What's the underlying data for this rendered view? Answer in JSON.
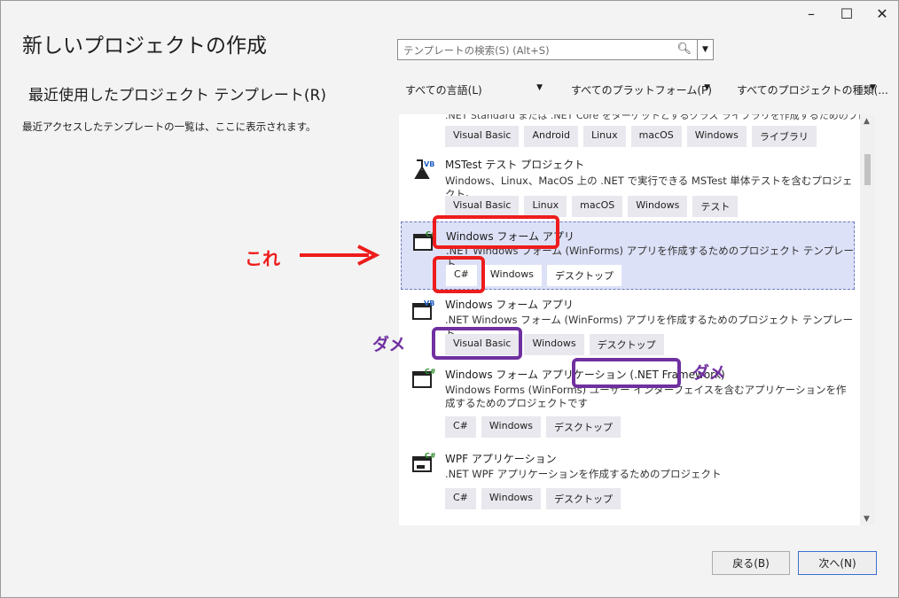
{
  "window": {
    "minimize_icon": "minimize-icon",
    "maximize_icon": "maximize-icon",
    "close_icon": "close-icon"
  },
  "title": "新しいプロジェクトの作成",
  "recent": {
    "heading": "最近使用したプロジェクト テンプレート(R)",
    "description": "最近アクセスしたテンプレートの一覧は、ここに表示されます。"
  },
  "search": {
    "placeholder": "テンプレートの検索(S) (Alt+S)"
  },
  "filters": {
    "language": "すべての言語(L)",
    "platform": "すべてのプラットフォーム(P)",
    "project_type": "すべてのプロジェクトの種類(..."
  },
  "templates": [
    {
      "name": "",
      "description": ".NET Standard または .NET Core をターゲットとするクラス ライブラリを作成するためのプロジェクト",
      "icon": "vb-library-icon",
      "tags": [
        "Visual Basic",
        "Android",
        "Linux",
        "macOS",
        "Windows",
        "ライブラリ"
      ]
    },
    {
      "name": "MSTest テスト プロジェクト",
      "description": "Windows、Linux、MacOS 上の .NET で実行できる MSTest 単体テストを含むプロジェクト。",
      "icon": "vb-flask-icon",
      "tags": [
        "Visual Basic",
        "Linux",
        "macOS",
        "Windows",
        "テスト"
      ]
    },
    {
      "name": "Windows フォーム アプリ",
      "description": ".NET Windows フォーム (WinForms) アプリを作成するためのプロジェクト テンプレート。",
      "icon": "csharp-window-icon",
      "tags": [
        "C#",
        "Windows",
        "デスクトップ"
      ]
    },
    {
      "name": "Windows フォーム アプリ",
      "description": ".NET Windows フォーム (WinForms) アプリを作成するためのプロジェクト テンプレート。",
      "icon": "vb-window-icon",
      "tags": [
        "Visual Basic",
        "Windows",
        "デスクトップ"
      ]
    },
    {
      "name": "Windows フォーム アプリケーション (.NET Framework)",
      "description": "Windows Forms (WinForms) ユーザー インターフェイスを含むアプリケーションを作成するためのプロジェクトです",
      "icon": "csharp-window-icon",
      "tags": [
        "C#",
        "Windows",
        "デスクトップ"
      ]
    },
    {
      "name": "WPF アプリケーション",
      "description": ".NET WPF アプリケーションを作成するためのプロジェクト",
      "icon": "csharp-wpf-icon",
      "tags": [
        "C#",
        "Windows",
        "デスクトップ"
      ]
    }
  ],
  "buttons": {
    "back": "戻る(B)",
    "next": "次へ(N)"
  },
  "annotations": {
    "this_one": "これ",
    "no_good_1": "ダメ",
    "no_good_2": "ダメ",
    "red_color": "#ee1c1c",
    "purple_color": "#7030a0"
  },
  "colors": {
    "selected_bg": "#dde1f7",
    "accent": "#3c6fd1"
  }
}
